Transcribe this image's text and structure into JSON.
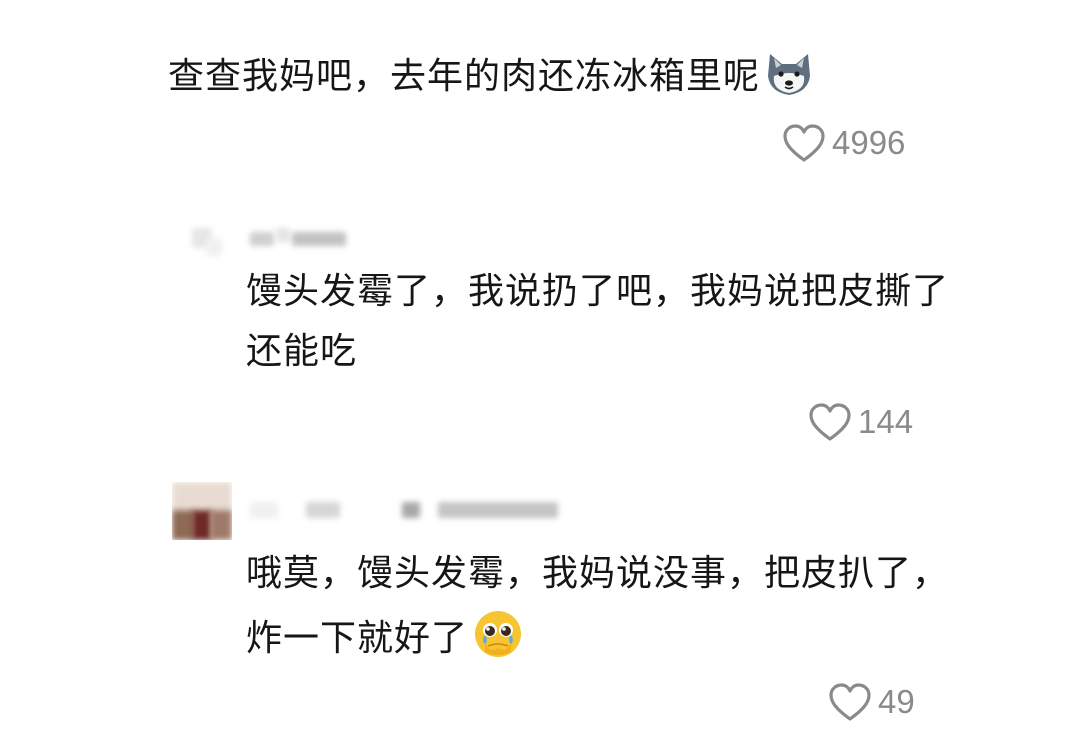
{
  "comments": [
    {
      "text": "查查我妈吧，去年的肉还冻冰箱里呢",
      "emoji": "wolf-face",
      "likes": "4996"
    },
    {
      "lines": [
        "馒头发霉了，我说扔了吧，我妈说把皮撕了",
        "还能吃"
      ],
      "likes": "144"
    },
    {
      "lines": [
        "哦莫，馒头发霉，我妈说没事，把皮扒了，",
        "炸一下就好了"
      ],
      "emoji": "pleading-face",
      "likes": "49"
    }
  ],
  "icons": {
    "like": "heart-outline-icon"
  },
  "colors": {
    "text": "#161616",
    "meta": "#8a8a8a",
    "background": "#ffffff"
  }
}
